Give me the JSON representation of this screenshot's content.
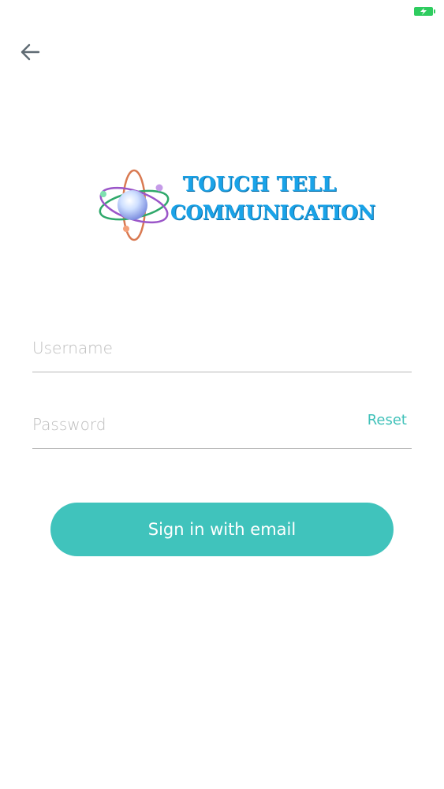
{
  "status_bar": {
    "battery_icon": "battery-charging-icon"
  },
  "header": {
    "back_icon": "arrow-left-icon"
  },
  "logo": {
    "line1": "TOUCH TELL",
    "line2": "COMMUNICATION"
  },
  "form": {
    "username": {
      "value": "",
      "placeholder": "Username"
    },
    "password": {
      "value": "",
      "placeholder": "Password"
    },
    "reset_label": "Reset",
    "submit_label": "Sign in with email"
  },
  "colors": {
    "accent": "#40c3bc",
    "reset_text": "#3fc1b9",
    "logo_text": "#1aa3e8",
    "battery": "#2ecc5f",
    "back_arrow": "#5f6b73"
  }
}
